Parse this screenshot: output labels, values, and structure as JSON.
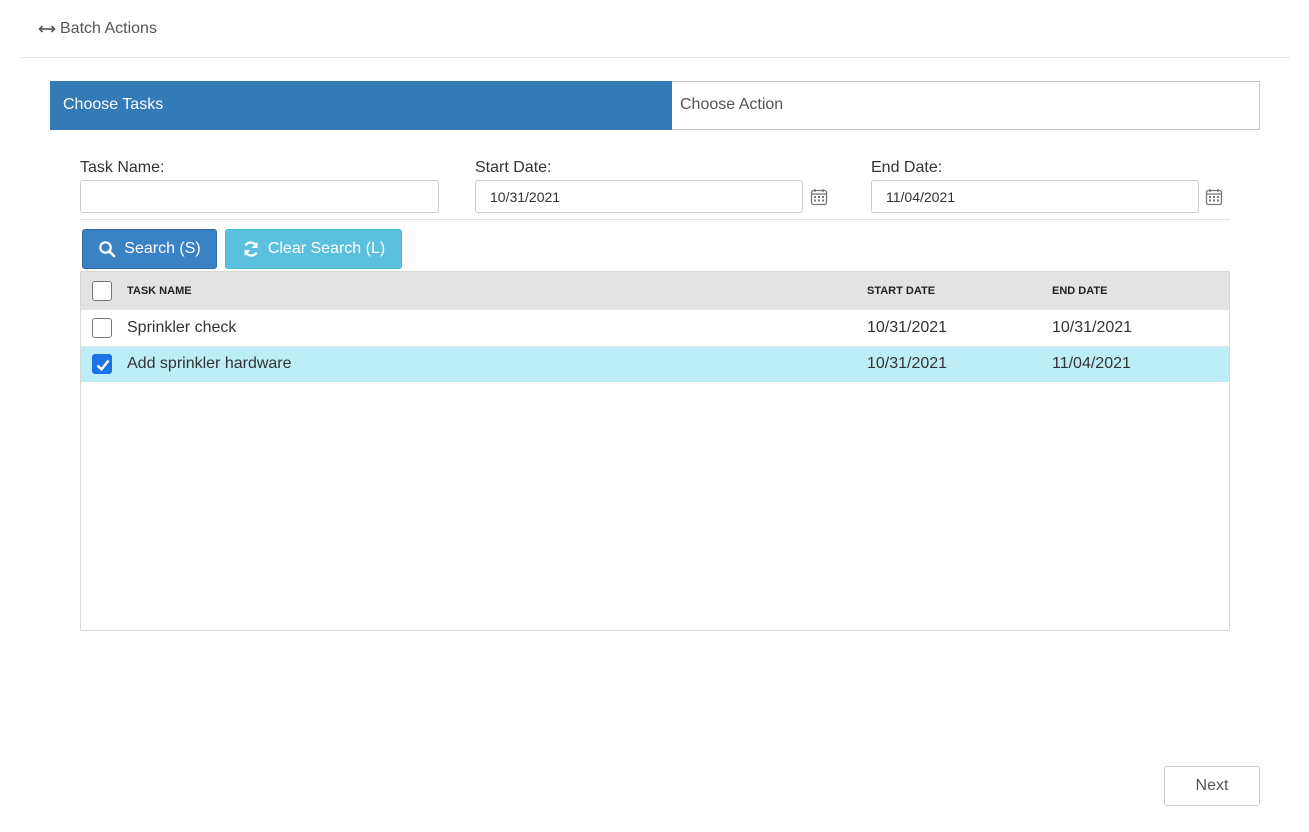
{
  "header": {
    "title": "Batch Actions",
    "icon": "left-right-arrow-icon"
  },
  "wizard": {
    "steps": [
      {
        "label": "Choose Tasks",
        "active": true
      },
      {
        "label": "Choose Action",
        "active": false
      }
    ],
    "active_color": "#337ab7"
  },
  "filters": {
    "task_name": {
      "label": "Task Name:",
      "value": ""
    },
    "start_date": {
      "label": "Start Date:",
      "value": "10/31/2021",
      "icon": "calendar-icon"
    },
    "end_date": {
      "label": "End Date:",
      "value": "11/04/2021",
      "icon": "calendar-icon"
    }
  },
  "buttons": {
    "search": {
      "label": "Search (S)",
      "icon": "search-icon",
      "color": "#3b82c4"
    },
    "clear": {
      "label": "Clear Search (L)",
      "icon": "refresh-icon",
      "color": "#5bc0de"
    },
    "next": {
      "label": "Next"
    }
  },
  "grid": {
    "columns": [
      "TASK NAME",
      "START DATE",
      "END DATE"
    ],
    "rows": [
      {
        "checked": false,
        "task_name": "Sprinkler check",
        "start_date": "10/31/2021",
        "end_date": "10/31/2021"
      },
      {
        "checked": true,
        "task_name": "Add sprinkler hardware",
        "start_date": "10/31/2021",
        "end_date": "11/04/2021"
      }
    ],
    "selected_row_color": "#bdedf7"
  }
}
